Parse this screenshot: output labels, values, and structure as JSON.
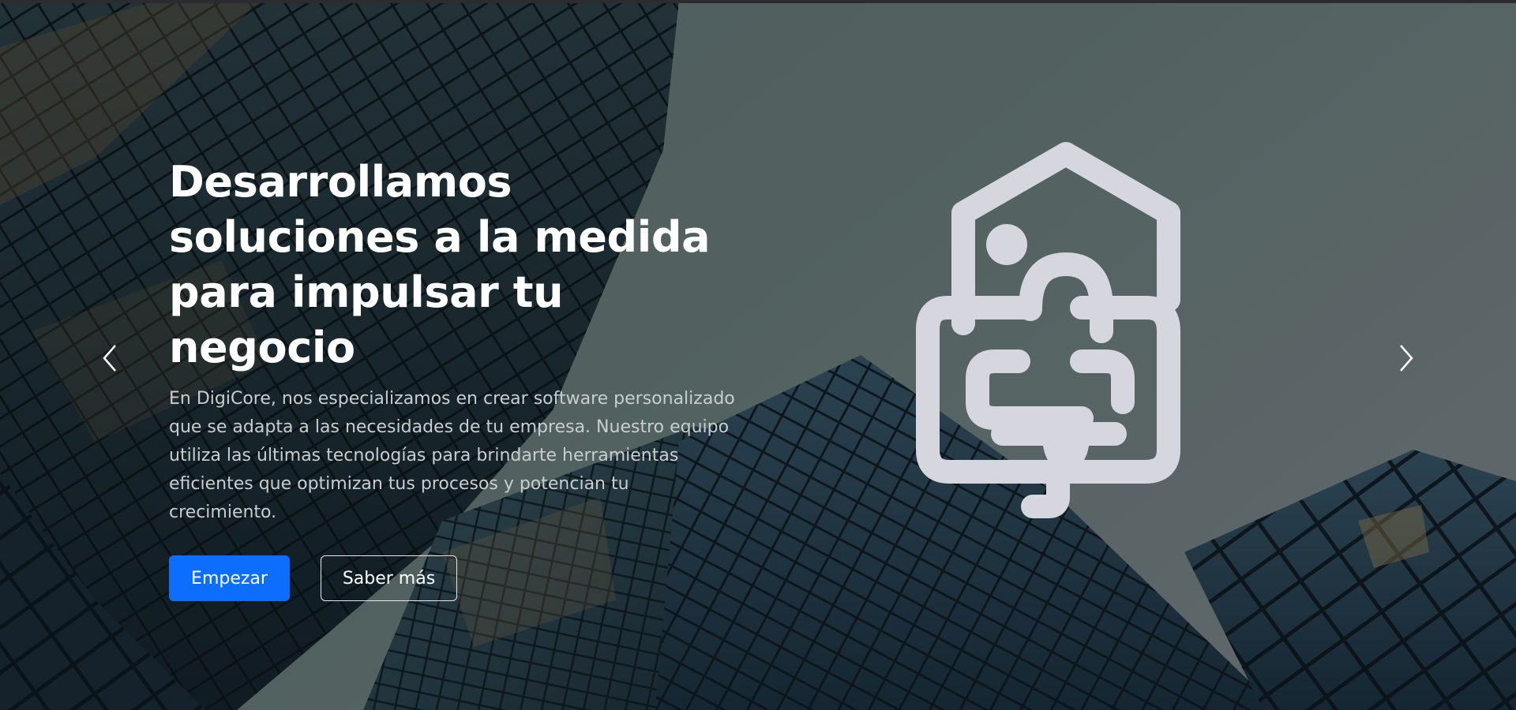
{
  "hero": {
    "headline": "Desarrollamos soluciones a la medida para impulsar tu negocio",
    "description": "En DigiCore, nos especializamos en crear software personalizado que se adapta a las necesidades de tu empresa. Nuestro equipo utiliza las últimas tecnologías para brindarte herramientas eficientes que optimizan tus procesos y potencian tu crecimiento.",
    "primary_button": "Empezar",
    "secondary_button": "Saber más"
  },
  "carousel": {
    "prev_icon": "chevron-left-icon",
    "next_icon": "chevron-right-icon"
  },
  "illustration": {
    "icon": "house-printer-icon",
    "color": "#d6d6de"
  },
  "colors": {
    "primary": "#0d6efd",
    "heading": "#ffffff",
    "lead": "#c8cdd0"
  }
}
